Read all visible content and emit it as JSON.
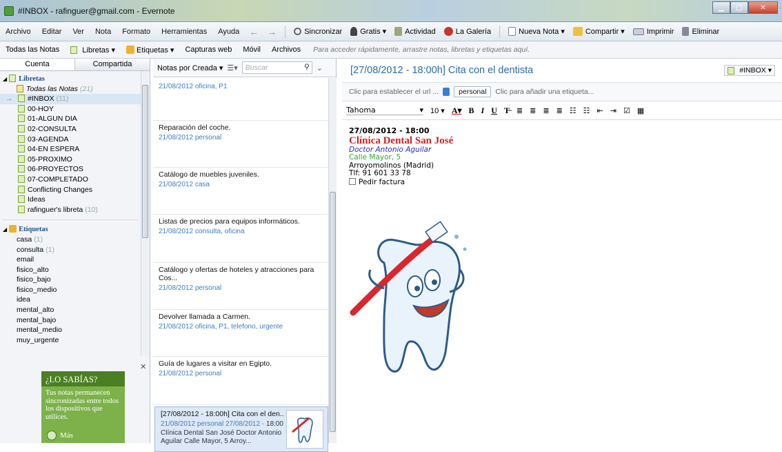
{
  "window": {
    "title": "#INBOX - rafinguer@gmail.com - Evernote"
  },
  "menu": [
    "Archivo",
    "Editar",
    "Ver",
    "Nota",
    "Formato",
    "Herramientas",
    "Ayuda"
  ],
  "toolbar": {
    "sync": "Sincronizar",
    "free": "Gratis ▾",
    "activity": "Actividad",
    "gallery": "La Galería",
    "new_note": "Nueva Nota ▾",
    "share": "Compartir ▾",
    "print": "Imprimir",
    "delete": "Eliminar"
  },
  "nav": {
    "all_notes": "Todas las Notas",
    "notebooks": "Libretas ▾",
    "tags": "Etiquetas ▾",
    "web_clips": "Capturas web",
    "mobile": "Móvil",
    "files": "Archivos",
    "hint": "Para acceder rápidamente, arrastre notas, libretas y etiquetas aquí."
  },
  "sidebar": {
    "tab_account": "Cuenta",
    "tab_shared": "Compartida",
    "notebooks_header": "Libretas",
    "all_notes": {
      "label": "Todas las Notas",
      "count": "(21)"
    },
    "notebooks": [
      {
        "label": "#INBOX",
        "count": "(11)"
      },
      {
        "label": "00-HOY",
        "count": ""
      },
      {
        "label": "01-ALGUN DIA",
        "count": ""
      },
      {
        "label": "02-CONSULTA",
        "count": ""
      },
      {
        "label": "03-AGENDA",
        "count": ""
      },
      {
        "label": "04-EN ESPERA",
        "count": ""
      },
      {
        "label": "05-PROXIMO",
        "count": ""
      },
      {
        "label": "06-PROYECTOS",
        "count": ""
      },
      {
        "label": "07-COMPLETADO",
        "count": ""
      },
      {
        "label": "Conflicting Changes",
        "count": ""
      },
      {
        "label": "Ideas",
        "count": ""
      },
      {
        "label": "rafinguer's libreta",
        "count": "(10)"
      }
    ],
    "tags_header": "Etiquetas",
    "tags": [
      {
        "label": "casa",
        "count": "(1)"
      },
      {
        "label": "consulta",
        "count": "(1)"
      },
      {
        "label": "email",
        "count": ""
      },
      {
        "label": "fisico_alto",
        "count": ""
      },
      {
        "label": "fisico_bajo",
        "count": ""
      },
      {
        "label": "fisico_medio",
        "count": ""
      },
      {
        "label": "idea",
        "count": ""
      },
      {
        "label": "mental_alto",
        "count": ""
      },
      {
        "label": "mental_bajo",
        "count": ""
      },
      {
        "label": "mental_medio",
        "count": ""
      },
      {
        "label": "muy_urgente",
        "count": ""
      }
    ],
    "tip_title": "¿LO SABÍAS?",
    "tip_text": "Tus notas permanecen sincronizadas entre todos los dispositivos que utilices.",
    "tip_more": "Más"
  },
  "notes_list": {
    "sort_label": "Notas por Creada ▾",
    "search_placeholder": "Buscar",
    "notes": [
      {
        "title": "",
        "meta": "21/08/2012  oficina, P1"
      },
      {
        "title": "Reparación del coche.",
        "meta": "21/08/2012  personal"
      },
      {
        "title": "Catálogo de muebles juveniles.",
        "meta": "21/08/2012  casa"
      },
      {
        "title": "Listas de precios para equipos informáticos.",
        "meta": "21/08/2012  consulta, oficina"
      },
      {
        "title": "Catálogo y ofertas de hoteles y atracciones para Cos...",
        "meta": "21/08/2012  personal"
      },
      {
        "title": "Devolver llamada a Carmen.",
        "meta": "21/08/2012  oficina, P1, telefono, urgente"
      },
      {
        "title": "Guía de lugares a visitar en Egipto.",
        "meta": "21/08/2012  personal"
      }
    ],
    "selected": {
      "title": "[27/08/2012 - 18:00h] Cita con el den...",
      "meta": "21/08/2012  personal  27/08/2012 -",
      "snippet": "18:00 Clínica Dental San José Doctor Antonio Aguilar Calle Mayor, 5 Arroy..."
    }
  },
  "editor": {
    "title": "[27/08/2012 - 18:00h] Cita con el dentista",
    "notebook": "#INBOX ▾",
    "url_hint": "Clic para establecer el url ...",
    "tag": "personal",
    "tag_hint": "Clic para añadir una etiqueta...",
    "font": "Tahoma",
    "size": "10",
    "body": {
      "line1": "27/08/2012 - 18:00",
      "line2": "Clínica Dental San José",
      "line3": "Doctor Antonio Aguilar",
      "line4": "Calle Mayor, 5",
      "line5": "Arroyomolinos (Madrid)",
      "line6": "Tlf: 91 601 33 78",
      "line7": "Pedir factura"
    }
  }
}
